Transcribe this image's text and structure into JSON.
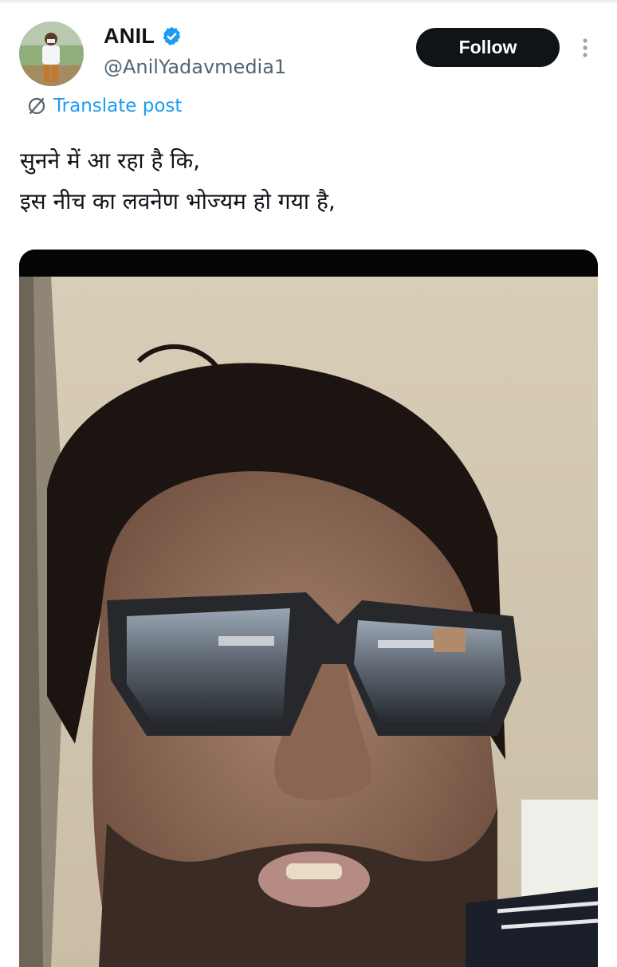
{
  "author": {
    "name": "ANIL",
    "handle": "@AnilYadavmedia1",
    "verified": true
  },
  "actions": {
    "follow_label": "Follow"
  },
  "translate": {
    "label": "Translate post"
  },
  "post": {
    "text": "सुनने में आ रहा है कि,\nइस नीच का लवनेण भोज्यम हो गया है,"
  },
  "colors": {
    "text": "#0f1419",
    "secondary": "#536471",
    "accent": "#1d9bf0",
    "follow_bg": "#0f1419"
  },
  "icons": [
    "verified-badge-icon",
    "more-options-icon",
    "translate-icon"
  ]
}
